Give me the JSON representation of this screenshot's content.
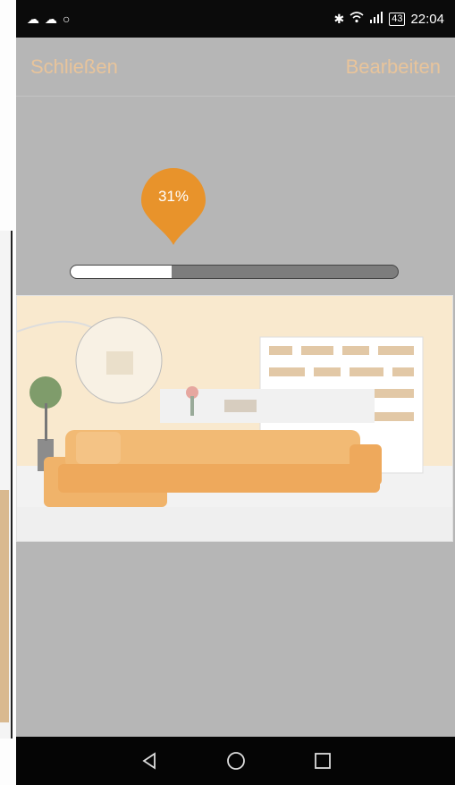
{
  "status_bar": {
    "left_icons": [
      "cloud-icon",
      "cloud-icon",
      "circle-icon"
    ],
    "right_icons": [
      "bluetooth-icon",
      "wifi-icon",
      "signal-icon"
    ],
    "battery": "43",
    "time": "22:04"
  },
  "header": {
    "close_label": "Schließen",
    "edit_label": "Bearbeiten"
  },
  "progress": {
    "percent_label": "31%",
    "value": 0.31
  },
  "nav_bar": {
    "icons": [
      "back-icon",
      "home-icon",
      "recents-icon"
    ]
  },
  "colors": {
    "accent": "#e8932b",
    "header_text": "#e8c49b",
    "overlay": "#b6b6b6"
  }
}
